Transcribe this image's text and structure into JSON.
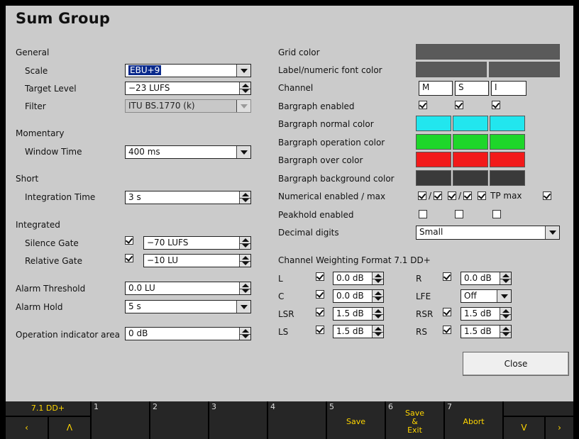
{
  "title": "Sum Group",
  "general": {
    "heading": "General",
    "scale_label": "Scale",
    "scale_value": "EBU+9",
    "target_label": "Target Level",
    "target_value": "−23 LUFS",
    "filter_label": "Filter",
    "filter_value": "ITU BS.1770 (k)"
  },
  "momentary": {
    "heading": "Momentary",
    "window_label": "Window Time",
    "window_value": "400 ms"
  },
  "short": {
    "heading": "Short",
    "integration_label": "Integration Time",
    "integration_value": "3 s"
  },
  "integrated": {
    "heading": "Integrated",
    "silence_label": "Silence Gate",
    "silence_value": "−70 LUFS",
    "silence_checked": true,
    "relative_label": "Relative Gate",
    "relative_value": "−10 LU",
    "relative_checked": true
  },
  "alarm": {
    "threshold_label": "Alarm Threshold",
    "threshold_value": "0.0 LU",
    "hold_label": "Alarm Hold",
    "hold_value": "5 s"
  },
  "operation": {
    "label": "Operation indicator area",
    "value": "0 dB"
  },
  "right": {
    "grid_color_label": "Grid color",
    "font_color_label": "Label/numeric font color",
    "channel_label": "Channel",
    "channels": [
      "M",
      "S",
      "I"
    ],
    "bargraph_enabled_label": "Bargraph enabled",
    "bargraph_normal_label": "Bargraph normal color",
    "bargraph_operation_label": "Bargraph operation color",
    "bargraph_over_label": "Bargraph over color",
    "bargraph_background_label": "Bargraph background color",
    "numerical_label": "Numerical enabled / max",
    "tp_max_label": "TP max",
    "slash": "/",
    "peakhold_label": "Peakhold enabled",
    "decimal_label": "Decimal digits",
    "decimal_value": "Small"
  },
  "colors": {
    "grid": "#5a5a5a",
    "font": "#5a5a5a",
    "normal": "#22e6ee",
    "operation": "#1ed62a",
    "over": "#f21a1a",
    "background": "#3a3a3a"
  },
  "weighting": {
    "heading": "Channel Weighting Format 7.1 DD+",
    "left": [
      {
        "label": "L",
        "value": "0.0 dB",
        "checked": true
      },
      {
        "label": "C",
        "value": "0.0 dB",
        "checked": true
      },
      {
        "label": "LSR",
        "value": "1.5 dB",
        "checked": true
      },
      {
        "label": "LS",
        "value": "1.5 dB",
        "checked": true
      }
    ],
    "right": [
      {
        "label": "R",
        "value": "0.0 dB",
        "checked": true
      },
      {
        "label": "LFE",
        "value": "Off"
      },
      {
        "label": "RSR",
        "value": "1.5 dB",
        "checked": true
      },
      {
        "label": "RS",
        "value": "1.5 dB",
        "checked": true
      }
    ]
  },
  "close_label": "Close",
  "softkeys": {
    "preset": "7.1 DD+",
    "left_arrow": "‹",
    "up_arrow": "Λ",
    "nums": [
      "1",
      "2",
      "3",
      "4",
      "5",
      "6",
      "7"
    ],
    "save": "Save",
    "save_exit_1": "Save",
    "save_exit_2": "&",
    "save_exit_3": "Exit",
    "abort": "Abort",
    "down_arrow": "V",
    "right_arrow": "›"
  }
}
